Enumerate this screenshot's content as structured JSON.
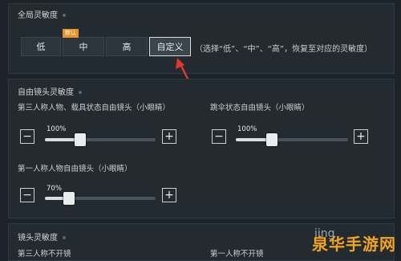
{
  "global": {
    "title": "全局灵敏度",
    "options": [
      "低",
      "中",
      "高",
      "自定义"
    ],
    "badge": "默认",
    "hint": "（选择“低”、“中”、“高”，恢复至对应的灵敏度）",
    "selected": "自定义"
  },
  "free_cam": {
    "title": "自由镜头灵敏度",
    "sliders": [
      {
        "label": "第三人称人物、载具状态自由镜头（小眼睛）",
        "value": "100%",
        "fraction": 0.33
      },
      {
        "label": "跳伞状态自由镜头（小眼睛）",
        "value": "100%",
        "fraction": 0.33
      },
      {
        "label": "第一人称人物自由镜头（小眼睛）",
        "value": "70%",
        "fraction": 0.23
      }
    ]
  },
  "lens": {
    "title": "镜头灵敏度",
    "left_label": "第三人称不开镜",
    "right_label": "第一人称不开镜"
  },
  "controls": {
    "minus": "−",
    "plus": "+"
  },
  "watermark": {
    "text": "泉华手游网",
    "sub": "jing"
  },
  "colors": {
    "accent": "#e7922a",
    "arrow": "#e0362c"
  }
}
